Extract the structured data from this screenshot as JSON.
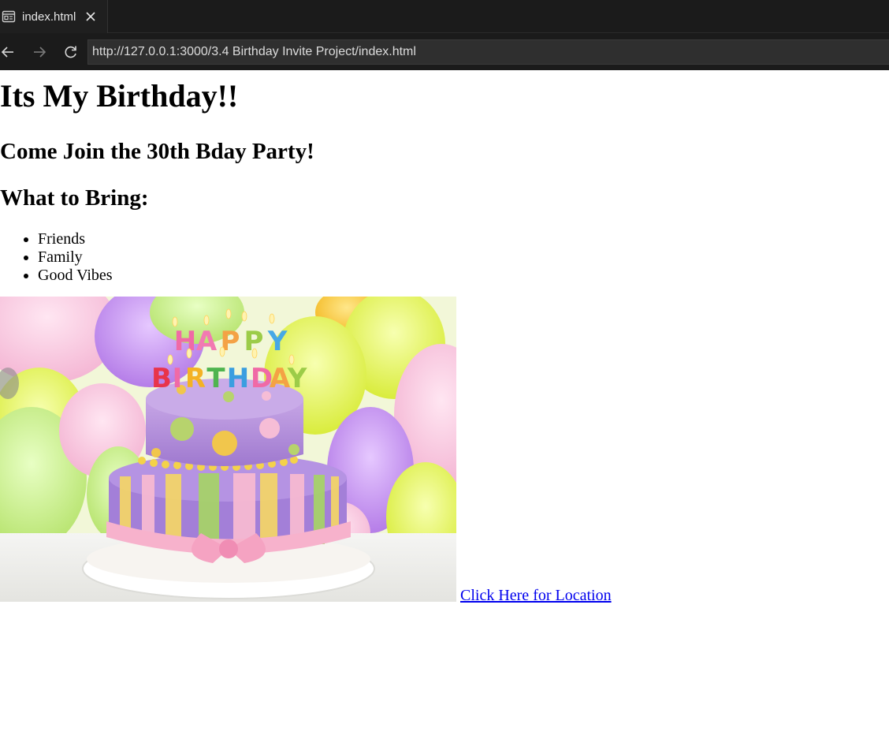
{
  "browser": {
    "tab": {
      "title": "index.html",
      "icon": "page-preview-icon",
      "close_icon": "close-icon"
    },
    "nav": {
      "back_icon": "back-arrow-icon",
      "forward_icon": "forward-arrow-icon",
      "reload_icon": "reload-icon"
    },
    "url": "http://127.0.0.1:3000/3.4 Birthday Invite Project/index.html"
  },
  "page": {
    "heading": "Its My Birthday!!",
    "subheading": "Come Join the 30th Bday Party!",
    "list_heading": "What to Bring:",
    "bring_items": [
      "Friends",
      "Family",
      "Good Vibes"
    ],
    "image": {
      "subject": "birthday-cake-photo",
      "cake_text": [
        "HAPPY",
        "BIRTHDAY"
      ]
    },
    "location_link": "Click Here for Location"
  },
  "colors": {
    "chrome_bg": "#1b1b1b",
    "url_bg": "#2f2f2f",
    "link": "#0000ee"
  }
}
